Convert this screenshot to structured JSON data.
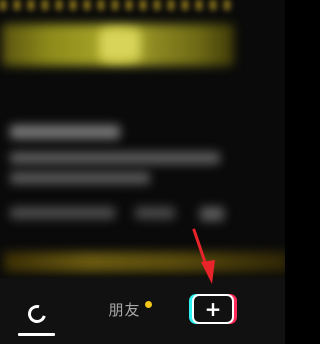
{
  "nav": {
    "home_icon": "refresh-home-icon",
    "friends_label": "朋友",
    "create_label": "+",
    "badge_color": "#f5c518"
  },
  "colors": {
    "accent_cyan": "#2ef2f2",
    "accent_red": "#ff2a59",
    "arrow": "#e8232a"
  }
}
